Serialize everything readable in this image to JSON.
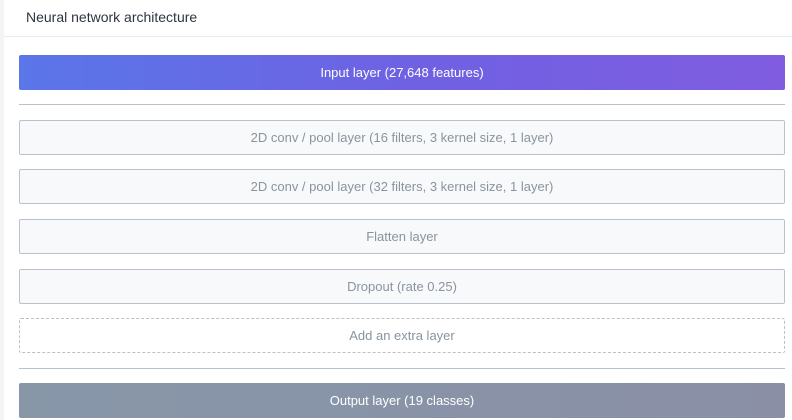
{
  "header": {
    "title": "Neural network architecture"
  },
  "layers": {
    "input": "Input layer (27,648 features)",
    "hidden": [
      "2D conv / pool layer (16 filters, 3 kernel size, 1 layer)",
      "2D conv / pool layer (32 filters, 3 kernel size, 1 layer)",
      "Flatten layer",
      "Dropout (rate 0.25)"
    ],
    "add_label": "Add an extra layer",
    "output": "Output layer (19 classes)"
  },
  "colors": {
    "input_gradient_start": "#5a76e8",
    "input_gradient_end": "#805de0",
    "output_background": "#8a93a8",
    "hidden_border": "#b9c2cb"
  }
}
